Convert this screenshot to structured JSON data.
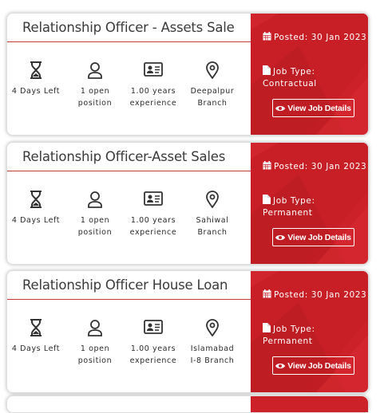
{
  "jobs": [
    {
      "title": "Relationship Officer - Assets Sale",
      "days_left": "4 Days Left",
      "positions": "1 open position",
      "experience": "1.00 years experience",
      "location": "Deepalpur Branch",
      "posted": "Posted: 30 Jan 2023",
      "job_type": "Job Type: Contractual",
      "button": "View Job Details"
    },
    {
      "title": "Relationship Officer-Asset Sales",
      "days_left": "4 Days Left",
      "positions": "1 open position",
      "experience": "1.00 years experience",
      "location": "Sahiwal Branch",
      "posted": "Posted: 30 Jan 2023",
      "job_type": "Job Type: Permanent",
      "button": "View Job Details"
    },
    {
      "title": "Relationship Officer House Loan",
      "days_left": "4 Days Left",
      "positions": "1 open position",
      "experience": "1.00 years experience",
      "location": "Islamabad I-8 Branch",
      "posted": "Posted: 30 Jan 2023",
      "job_type": "Job Type: Permanent",
      "button": "View Job Details"
    }
  ],
  "icons": {
    "days": "hourglass-icon",
    "positions": "user-icon",
    "experience": "id-card-icon",
    "location": "map-pin-icon",
    "posted": "calendar-icon",
    "job_type": "document-icon",
    "button": "eye-icon"
  },
  "colors": {
    "accent": "#cc2128",
    "rule": "#c63b38",
    "text": "#2b2b2b"
  }
}
